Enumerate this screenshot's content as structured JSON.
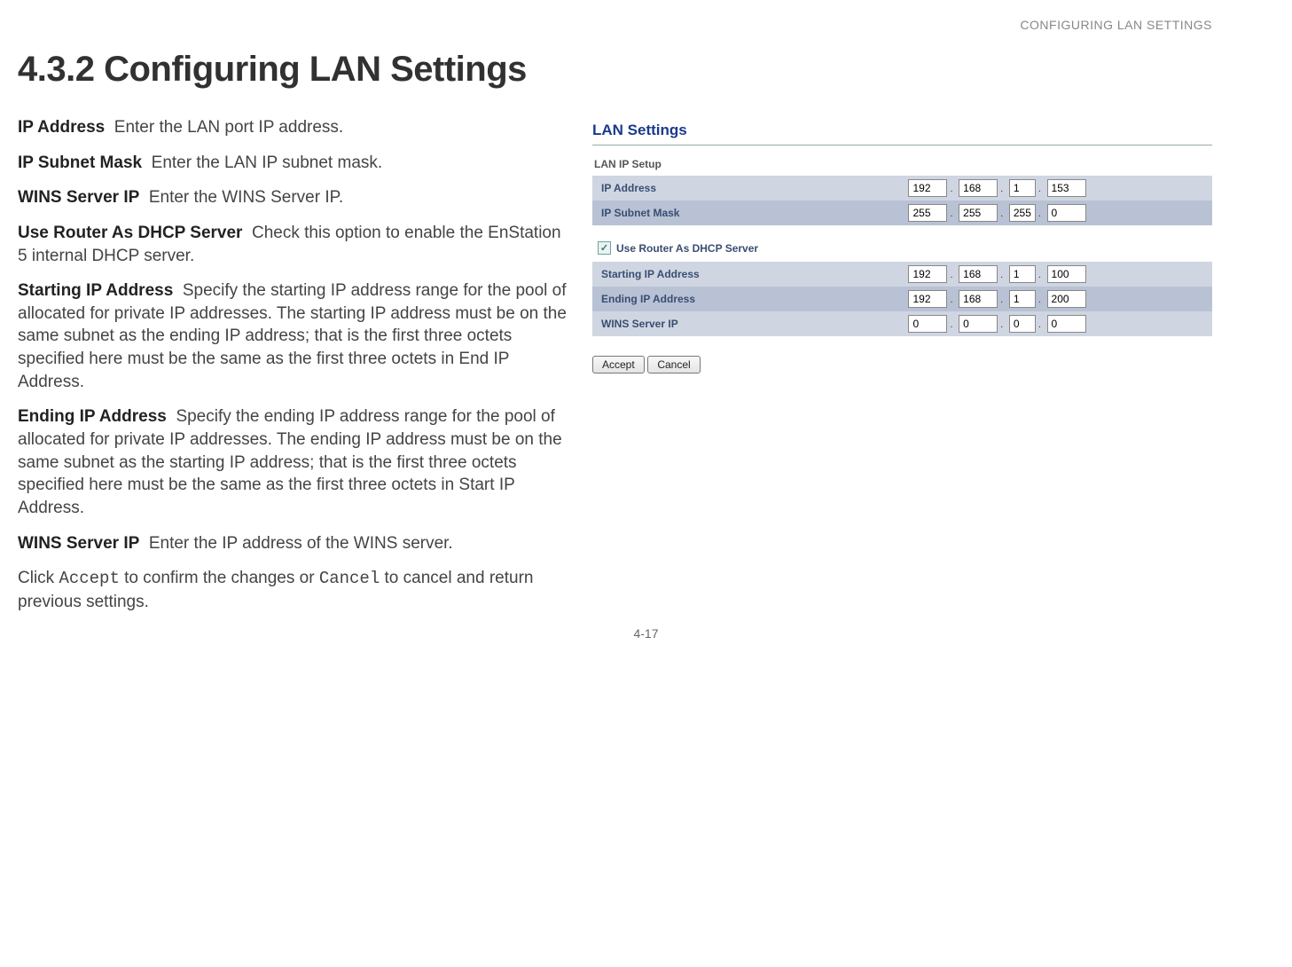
{
  "header": {
    "running": "CONFIGURING LAN SETTINGS"
  },
  "title": "4.3.2 Configuring LAN Settings",
  "descriptions": {
    "ip_address": {
      "term": "IP Address",
      "text": "Enter the LAN port IP address."
    },
    "subnet": {
      "term": "IP Subnet Mask",
      "text": "Enter the LAN IP subnet mask."
    },
    "wins1": {
      "term": "WINS Server IP",
      "text": "Enter the WINS Server IP."
    },
    "dhcp": {
      "term": "Use Router As DHCP Server",
      "text": "Check this option to enable the EnStation 5 internal DHCP server."
    },
    "start": {
      "term": "Starting IP Address",
      "text": "Specify the starting IP address range for the pool of allocated for private IP addresses. The starting IP address must be on the same subnet as the ending IP address; that is the first three octets specified here must be the same as the first three octets in End IP Address."
    },
    "end": {
      "term": "Ending IP Address",
      "text": "Specify the ending IP address range for the pool of allocated for private IP addresses. The ending IP address must be on the same subnet as the starting IP address; that is the first three octets specified here must be the same as the first three octets in Start IP Address."
    },
    "wins2": {
      "term": "WINS Server IP",
      "text": "Enter the IP address of the WINS server."
    },
    "footer": {
      "pre": "Click ",
      "accept": "Accept",
      "mid": " to confirm the changes or ",
      "cancel": "Cancel",
      "post": " to cancel and return previous settings."
    }
  },
  "panel": {
    "title": "LAN Settings",
    "section1": "LAN IP Setup",
    "rows1": {
      "ip": {
        "label": "IP Address",
        "oct": [
          "192",
          "168",
          "1",
          "153"
        ]
      },
      "mask": {
        "label": "IP Subnet Mask",
        "oct": [
          "255",
          "255",
          "255",
          "0"
        ]
      }
    },
    "dhcp_label": "Use Router As DHCP Server",
    "dhcp_checked": "✓",
    "rows2": {
      "start": {
        "label": "Starting IP Address",
        "oct": [
          "192",
          "168",
          "1",
          "100"
        ]
      },
      "end": {
        "label": "Ending IP Address",
        "oct": [
          "192",
          "168",
          "1",
          "200"
        ]
      },
      "wins": {
        "label": "WINS Server IP",
        "oct": [
          "0",
          "0",
          "0",
          "0"
        ]
      }
    },
    "buttons": {
      "accept": "Accept",
      "cancel": "Cancel"
    }
  },
  "page_number": "4-17"
}
